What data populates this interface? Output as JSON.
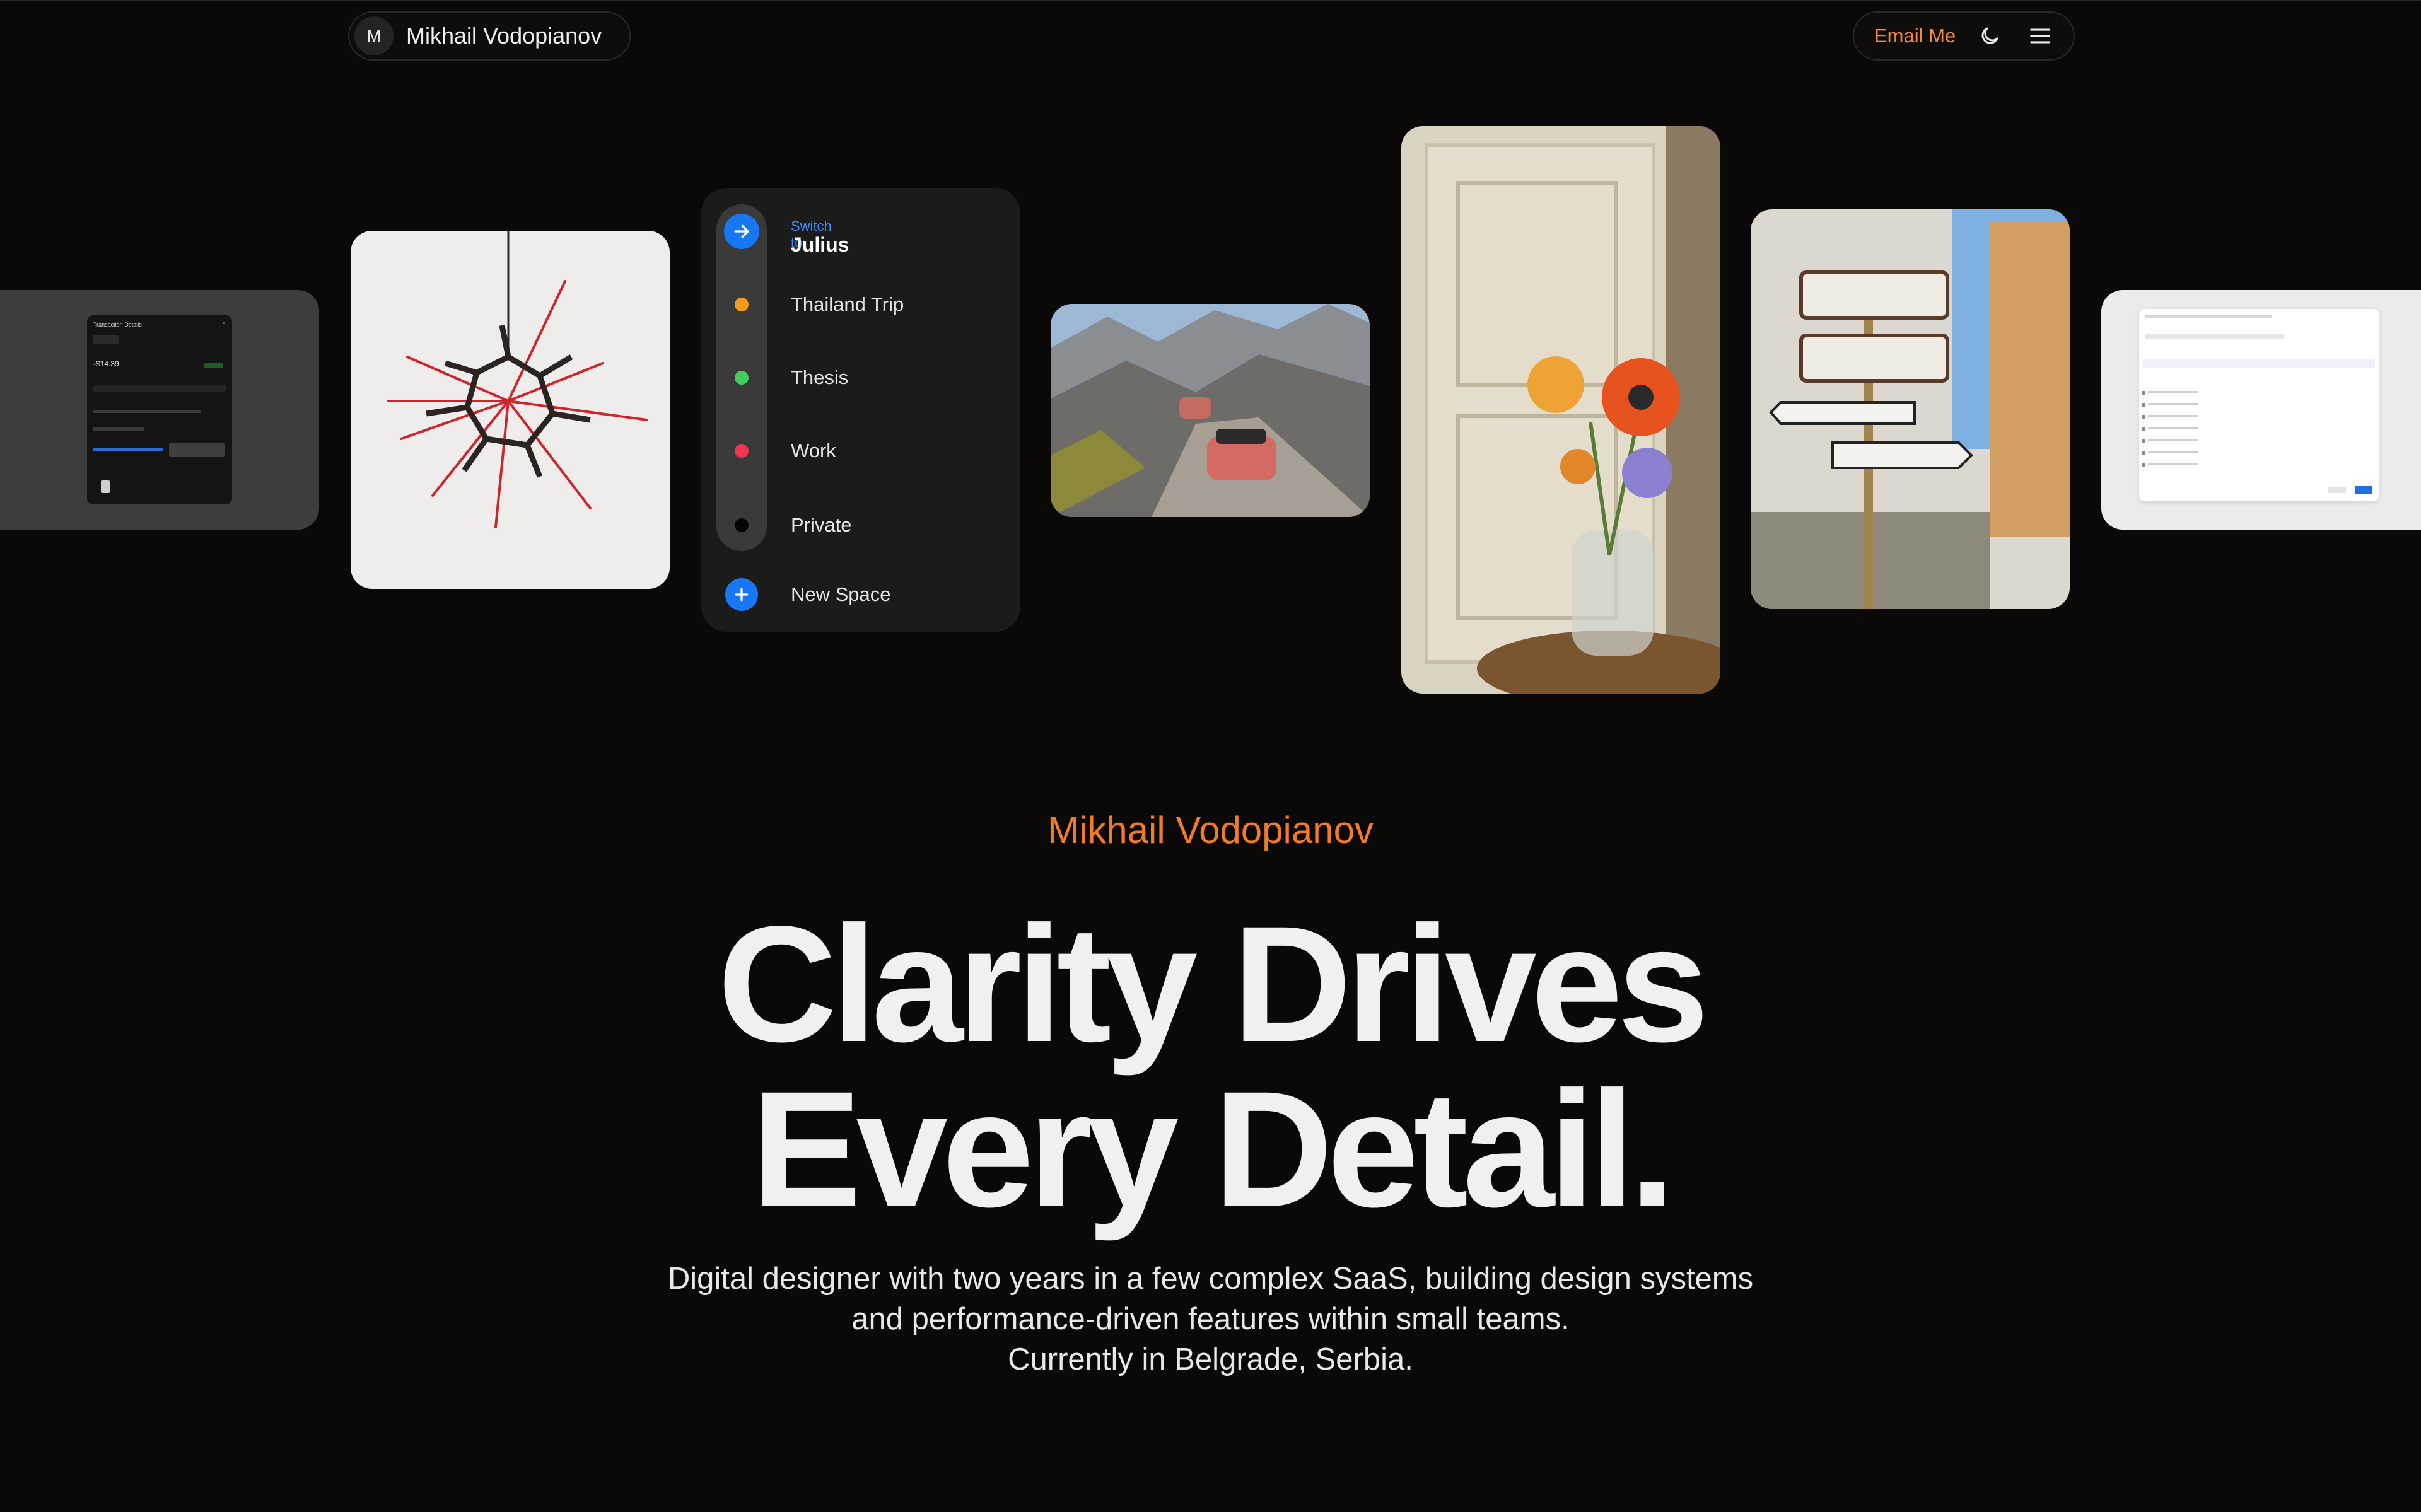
{
  "nav": {
    "avatar_initial": "M",
    "brand_name": "Mikhail Vodopianov",
    "email_label": "Email Me",
    "theme_icon": "moon-icon",
    "menu_icon": "hamburger-menu-icon",
    "accent_color": "#f28a3a"
  },
  "cards": {
    "spaces": {
      "switch_label": "Switch to",
      "switch_name": "Julius",
      "items": [
        {
          "label": "Thailand Trip",
          "color": "#f29a1e"
        },
        {
          "label": "Thesis",
          "color": "#3fcf5e"
        },
        {
          "label": "Work",
          "color": "#f0364f"
        },
        {
          "label": "Private",
          "color": "#000000"
        }
      ],
      "new_label": "New Space"
    },
    "transaction": {
      "title": "Transaction Details",
      "amount": "-$14.39"
    }
  },
  "hero": {
    "name": "Mikhail Vodopianov",
    "headline_line1": "Clarity Drives",
    "headline_line2": "Every Detail.",
    "bio_line1": "Digital designer with two years in a few complex SaaS, building design systems",
    "bio_line2": "and performance-driven features within small teams.",
    "bio_line3": "Currently in Belgrade, Serbia."
  }
}
